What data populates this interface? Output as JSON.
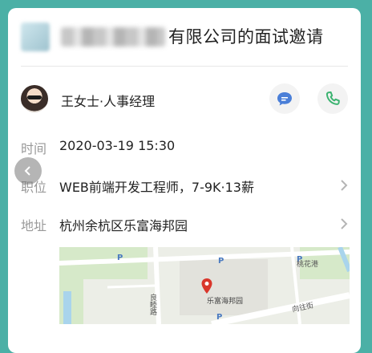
{
  "invitation": {
    "title_suffix": "有限公司的面试邀请"
  },
  "contact": {
    "name_title": "王女士·人事经理"
  },
  "details": {
    "time_label": "时间",
    "time_value": "2020-03-19 15:30",
    "position_label": "职位",
    "position_value": "WEB前端开发工程师，7-9K·13薪",
    "address_label": "地址",
    "address_value": "杭州余杭区乐富海邦园"
  },
  "map": {
    "destination": "乐富海邦园",
    "labels": [
      "桃花港",
      "向往街",
      "良睦路"
    ],
    "parking_marker": "P"
  },
  "colors": {
    "background": "#4bb0a6",
    "chat_icon": "#4a7fd8",
    "phone_icon": "#3cb371",
    "map_pin": "#d9362b"
  },
  "icons": {
    "chat": "chat-bubble-icon",
    "phone": "phone-icon",
    "back": "chevron-left-icon",
    "forward": "chevron-right-icon"
  }
}
